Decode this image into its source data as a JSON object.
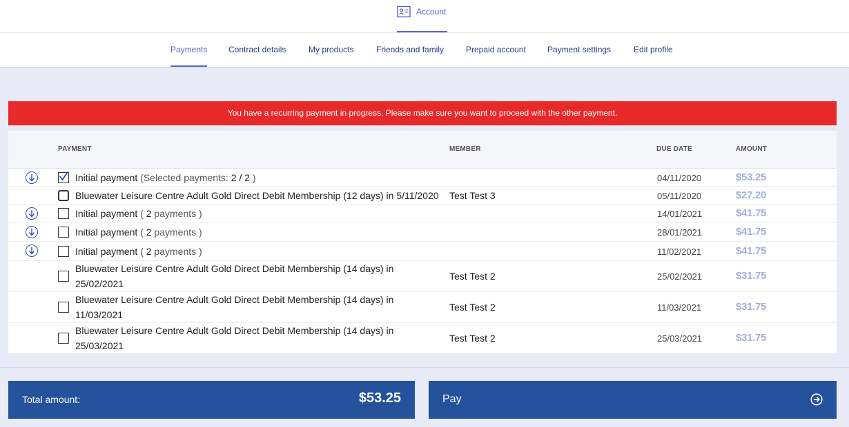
{
  "header": {
    "account_tab": {
      "label": "Account",
      "icon": "id-card-icon"
    }
  },
  "subnav": {
    "items": [
      {
        "label": "Payments",
        "active": true
      },
      {
        "label": "Contract details"
      },
      {
        "label": "My products"
      },
      {
        "label": "Friends and family"
      },
      {
        "label": "Prepaid account"
      },
      {
        "label": "Payment settings"
      },
      {
        "label": "Edit profile"
      }
    ]
  },
  "alert": {
    "text": "You have a recurring payment in progress. Please make sure you want to proceed with the other payment.",
    "color": "#e8292a"
  },
  "table": {
    "columns": {
      "payment": "PAYMENT",
      "member": "MEMBER",
      "due_date": "DUE DATE",
      "amount": "AMOUNT"
    },
    "rows": [
      {
        "expand": true,
        "checked": true,
        "title": "Initial payment",
        "detail_prefix": "(Selected payments: ",
        "detail_count": "2 / 2",
        "detail_suffix": " )",
        "member": "",
        "due": "04/11/2020",
        "amount": "$53.25"
      },
      {
        "expand": false,
        "checked": false,
        "title": "Bluewater Leisure Centre Adult Gold Direct Debit Membership (12 days) in 5/11/2020",
        "member": "Test Test 3",
        "due": "05/11/2020",
        "amount": "$27.20"
      },
      {
        "expand": true,
        "checked": false,
        "title": "Initial payment",
        "detail_prefix": "( ",
        "detail_count": "2",
        "detail_suffix": " payments )",
        "member": "",
        "due": "14/01/2021",
        "amount": "$41.75"
      },
      {
        "expand": true,
        "checked": false,
        "title": "Initial payment",
        "detail_prefix": "( ",
        "detail_count": "2",
        "detail_suffix": " payments )",
        "member": "",
        "due": "28/01/2021",
        "amount": "$41.75"
      },
      {
        "expand": true,
        "checked": false,
        "title": "Initial payment",
        "detail_prefix": "( ",
        "detail_count": "2",
        "detail_suffix": " payments )",
        "member": "",
        "due": "11/02/2021",
        "amount": "$41.75"
      },
      {
        "expand": false,
        "checked": false,
        "title_line1": "Bluewater Leisure Centre Adult Gold Direct Debit Membership (14 days) in",
        "title_line2": "25/02/2021",
        "member": "Test Test 2",
        "due": "25/02/2021",
        "amount": "$31.75"
      },
      {
        "expand": false,
        "checked": false,
        "title_line1": "Bluewater Leisure Centre Adult Gold Direct Debit Membership (14 days) in",
        "title_line2": "11/03/2021",
        "member": "Test Test 2",
        "due": "11/03/2021",
        "amount": "$31.75"
      },
      {
        "expand": false,
        "checked": false,
        "title_line1": "Bluewater Leisure Centre Adult Gold Direct Debit Membership (14 days) in",
        "title_line2": "25/03/2021",
        "member": "Test Test 2",
        "due": "25/03/2021",
        "amount": "$31.75"
      }
    ]
  },
  "footer": {
    "total_label": "Total amount:",
    "total_value": "$53.25",
    "pay_label": "Pay",
    "pay_icon": "arrow-circle-right-icon",
    "button_color": "#24529d"
  },
  "colors": {
    "accent": "#5b63c6",
    "nav_text": "#2b3a80",
    "amount": "#a8aed6"
  }
}
